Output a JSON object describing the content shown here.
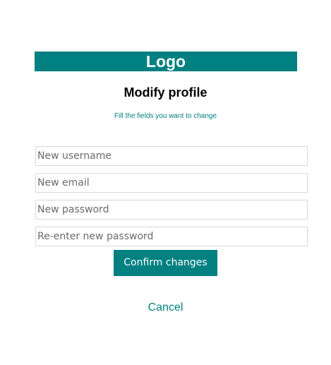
{
  "header": {
    "logo_text": "Logo"
  },
  "form": {
    "title": "Modify profile",
    "subtitle": "Fill the fields you want to change",
    "fields": {
      "username": {
        "placeholder": "New username",
        "value": ""
      },
      "email": {
        "placeholder": "New email",
        "value": ""
      },
      "password": {
        "placeholder": "New password",
        "value": ""
      },
      "password_repeat": {
        "placeholder": "Re-enter new password",
        "value": ""
      }
    },
    "confirm_label": "Confirm changes",
    "cancel_label": "Cancel"
  },
  "colors": {
    "accent": "#008080",
    "background": "#ffffff",
    "field_border": "#d9d9d9",
    "title_text": "#000000"
  }
}
